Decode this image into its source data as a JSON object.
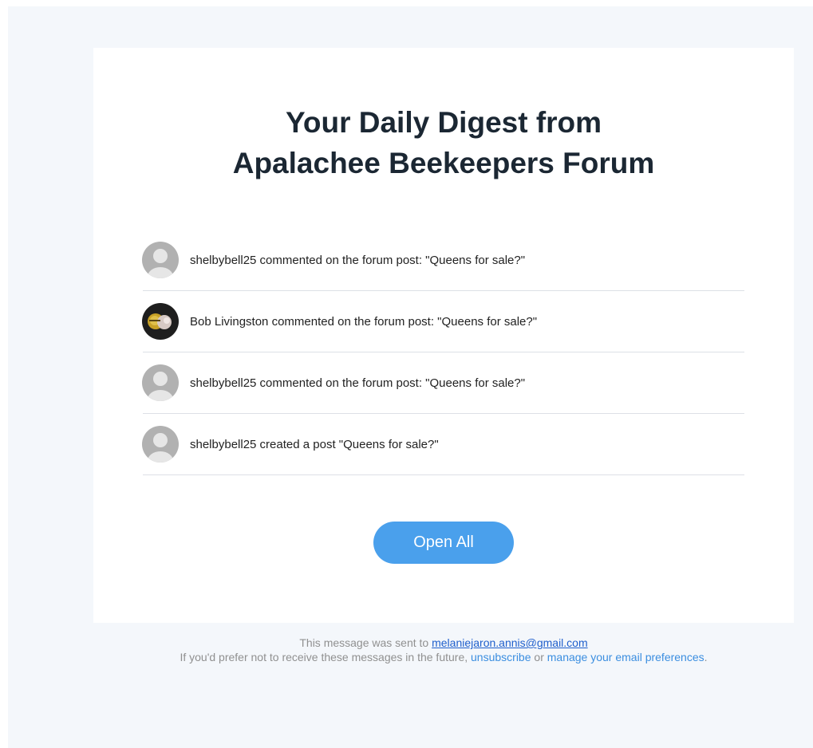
{
  "header": {
    "title_line1": "Your Daily Digest from",
    "title_line2": "Apalachee Beekeepers Forum"
  },
  "activity": [
    {
      "user": "shelbybell25",
      "text": "shelbybell25 commented on the forum post: \"Queens for sale?\"",
      "avatar": "default-avatar-icon"
    },
    {
      "user": "Bob Livingston",
      "text": "Bob Livingston commented on the forum post: \"Queens for sale?\"",
      "avatar": "bee-photo-avatar"
    },
    {
      "user": "shelbybell25",
      "text": "shelbybell25 commented on the forum post: \"Queens for sale?\"",
      "avatar": "default-avatar-icon"
    },
    {
      "user": "shelbybell25",
      "text": "shelbybell25 created a post \"Queens for sale?\"",
      "avatar": "default-avatar-icon"
    }
  ],
  "actions": {
    "open_all_label": "Open All"
  },
  "footer": {
    "sent_to_prefix": "This message was sent to ",
    "email": "melaniejaron.annis@gmail.com",
    "optout_prefix": "If you'd prefer not to receive these messages in the future, ",
    "unsubscribe_label": "unsubscribe",
    "or_text": " or ",
    "manage_label": "manage your email preferences",
    "period": "."
  },
  "colors": {
    "page_background": "#f4f7fb",
    "card_background": "#ffffff",
    "title_text": "#1b2733",
    "button_background": "#4aa0ec",
    "link": "#3b8ee0",
    "email_link": "#1f5fcc",
    "footer_text": "#909090"
  }
}
